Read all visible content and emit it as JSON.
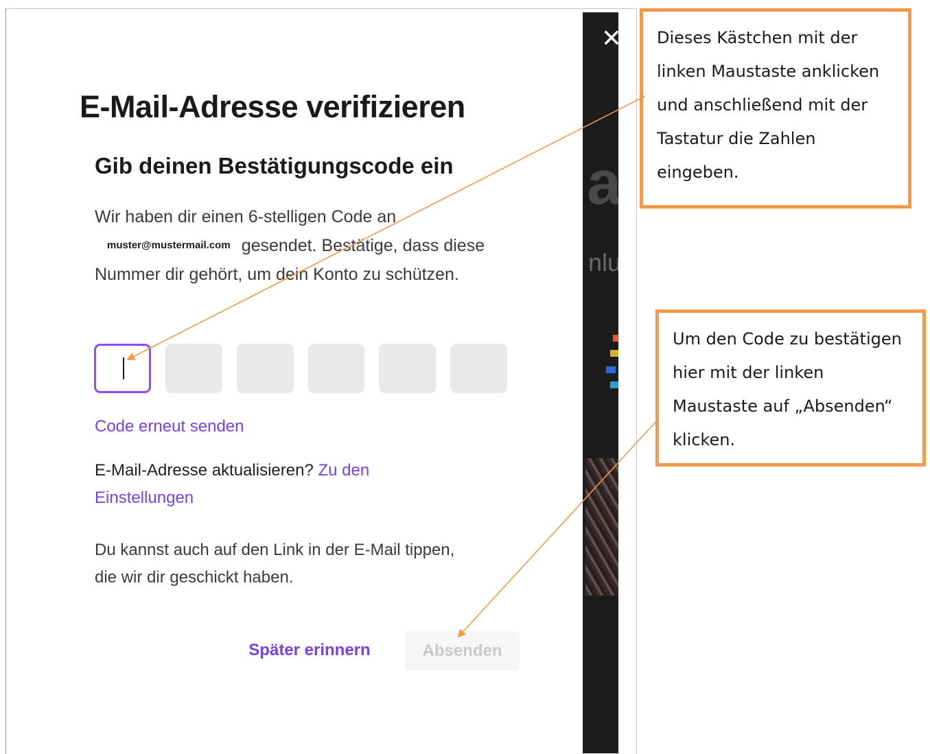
{
  "modal": {
    "title": "E-Mail-Adresse verifizieren",
    "subtitle": "Gib deinen Bestätigungscode ein",
    "description_part1": "Wir haben dir einen 6-stelligen Code an",
    "email": "muster@mustermail.com",
    "description_part2": "gesendet. Bestätige, dass diese Nummer dir gehört, um dein Konto zu schützen.",
    "code_length": 6,
    "resend_label": "Code erneut senden",
    "update_prompt": "E-Mail-Adresse aktualisieren?",
    "settings_link": "Zu den Einstellungen",
    "tap_hint": "Du kannst auch auf den Link in der E-Mail tippen, die wir dir geschickt haben.",
    "later_label": "Später erinnern",
    "submit_label": "Absenden",
    "close_icon": "close-icon"
  },
  "background": {
    "big_text": "al",
    "small_text": "nlu"
  },
  "callouts": {
    "first": [
      "Dieses Kästchen mit der",
      "linken Maustaste anklicken",
      "und anschließend mit der",
      "Tastatur die Zahlen",
      "eingeben."
    ],
    "second": [
      "Um den Code zu bestätigen",
      "hier mit der linken",
      "Maustaste auf „Absenden“",
      "klicken."
    ]
  },
  "colors": {
    "accent": "#9147ff",
    "link": "#7b3fe4",
    "callout_border": "#f29a4a"
  }
}
